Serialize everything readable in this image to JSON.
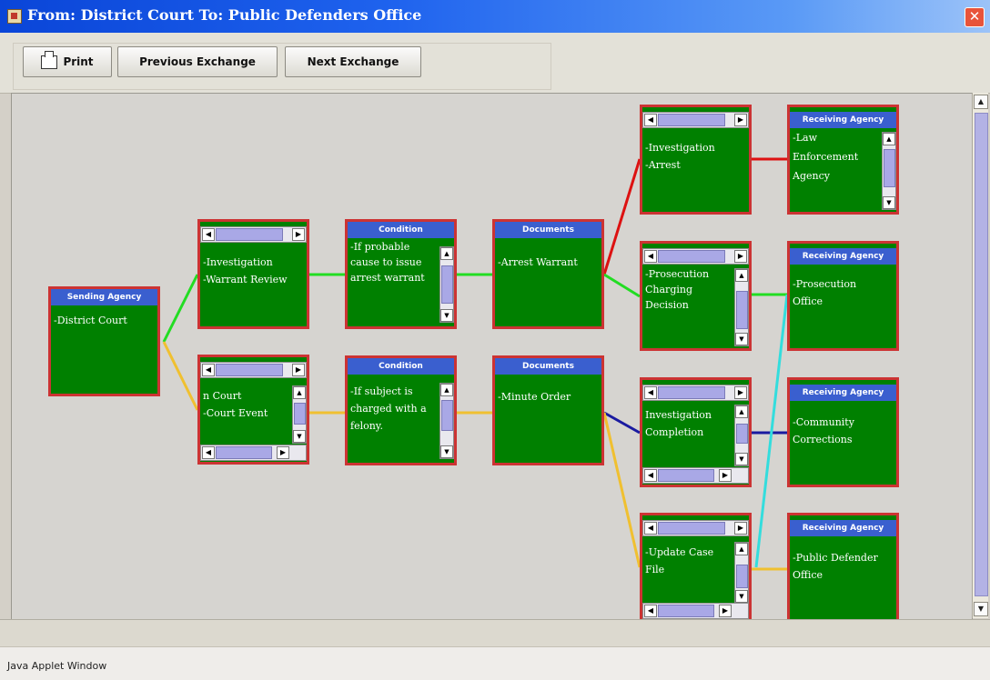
{
  "window": {
    "title": "From: District Court To: Public Defenders Office",
    "close_glyph": "✕"
  },
  "toolbar": {
    "print_label": "Print",
    "prev_label": "Previous Exchange",
    "next_label": "Next Exchange"
  },
  "status": {
    "text": "Java Applet Window"
  },
  "scroll_arrows": {
    "up": "▲",
    "down": "▼",
    "left": "◀",
    "right": "▶"
  },
  "colors": {
    "node_border": "#cc3333",
    "node_fill": "#008000",
    "header": "#3a5fcf",
    "red": "#dd1111",
    "green": "#22dd22",
    "yellow": "#f0c030",
    "navy": "#1a1aa0",
    "cyan": "#33dddd"
  },
  "nodes": {
    "sending": {
      "head": "Sending Agency",
      "body": "-District Court"
    },
    "activity_top": {
      "head": "",
      "body": "-Investigation\n-Warrant Review"
    },
    "activity_bottom": {
      "head": "",
      "body": "n Court\n-Court Event"
    },
    "condition_top": {
      "head": "Condition",
      "body": "-If probable\ncause to issue\narrest warrant"
    },
    "condition_bottom": {
      "head": "Condition",
      "body": "-If subject is\ncharged with a\nfelony."
    },
    "documents_top": {
      "head": "Documents",
      "body": "-Arrest Warrant"
    },
    "documents_bottom": {
      "head": "Documents",
      "body": "-Minute Order"
    },
    "sub1": {
      "head": "",
      "body": "-Investigation\n-Arrest"
    },
    "sub2": {
      "head": "",
      "body": "-Prosecution\nCharging\nDecision"
    },
    "sub3": {
      "head": "",
      "body": "Investigation\nCompletion"
    },
    "sub4": {
      "head": "",
      "body": "-Update Case\nFile"
    },
    "recv1": {
      "head": "Receiving Agency",
      "body": "-Law\nEnforcement\nAgency"
    },
    "recv2": {
      "head": "Receiving Agency",
      "body": "-Prosecution\nOffice"
    },
    "recv3": {
      "head": "Receiving Agency",
      "body": "-Community\nCorrections"
    },
    "recv4": {
      "head": "Receiving Agency",
      "body": "-Public Defender\nOffice"
    }
  }
}
